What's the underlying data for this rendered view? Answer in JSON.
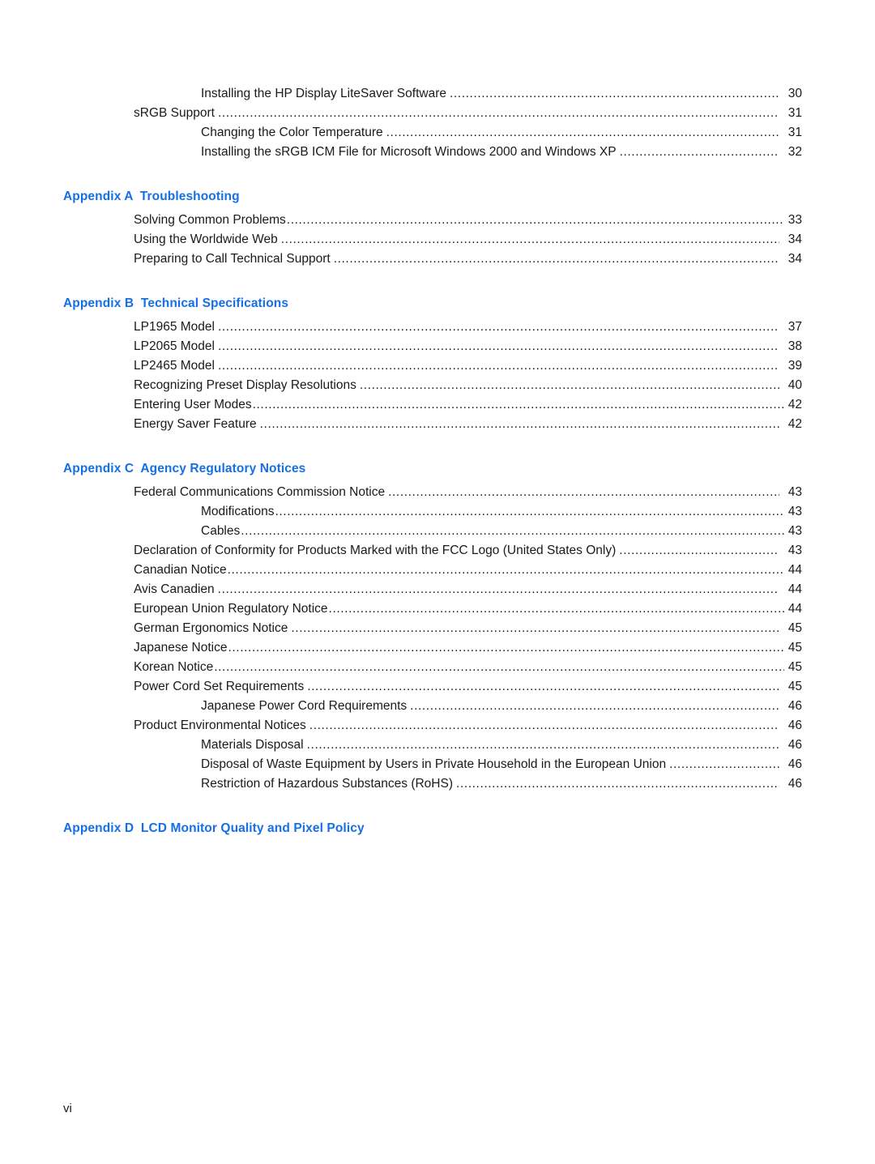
{
  "document": {
    "page_label": "vi",
    "heading_color": "#1570E8",
    "body_color": "#1a1a1a"
  },
  "toc": {
    "sections": [
      {
        "heading": "",
        "entries": [
          {
            "title": "Installing the HP Display LiteSaver Software",
            "page": "30",
            "level": 2,
            "tight": false
          },
          {
            "title": "sRGB Support",
            "page": "31",
            "level": 1,
            "tight": false
          },
          {
            "title": "Changing the Color Temperature",
            "page": "31",
            "level": 2,
            "tight": false
          },
          {
            "title": "Installing the sRGB ICM File for Microsoft Windows 2000 and Windows XP",
            "page": "32",
            "level": 2,
            "tight": false
          }
        ]
      },
      {
        "heading": "Appendix A  Troubleshooting",
        "entries": [
          {
            "title": "Solving Common Problems",
            "page": "33",
            "level": 1,
            "tight": true
          },
          {
            "title": "Using the Worldwide Web",
            "page": "34",
            "level": 1,
            "tight": false
          },
          {
            "title": "Preparing to Call Technical Support",
            "page": "34",
            "level": 1,
            "tight": false
          }
        ]
      },
      {
        "heading": "Appendix B  Technical Specifications",
        "entries": [
          {
            "title": "LP1965 Model",
            "page": "37",
            "level": 1,
            "tight": false
          },
          {
            "title": "LP2065 Model",
            "page": "38",
            "level": 1,
            "tight": false
          },
          {
            "title": "LP2465 Model",
            "page": "39",
            "level": 1,
            "tight": false
          },
          {
            "title": "Recognizing Preset Display Resolutions",
            "page": "40",
            "level": 1,
            "tight": false
          },
          {
            "title": "Entering User Modes",
            "page": "42",
            "level": 1,
            "tight": true
          },
          {
            "title": "Energy Saver Feature",
            "page": "42",
            "level": 1,
            "tight": false
          }
        ]
      },
      {
        "heading": "Appendix C  Agency Regulatory Notices",
        "entries": [
          {
            "title": "Federal Communications Commission Notice",
            "page": "43",
            "level": 1,
            "tight": false
          },
          {
            "title": "Modifications",
            "page": "43",
            "level": 2,
            "tight": true
          },
          {
            "title": "Cables",
            "page": "43",
            "level": 2,
            "tight": true
          },
          {
            "title": "Declaration of Conformity for Products Marked with the FCC Logo (United States Only)",
            "page": "43",
            "level": 1,
            "tight": false
          },
          {
            "title": "Canadian Notice",
            "page": "44",
            "level": 1,
            "tight": true
          },
          {
            "title": "Avis Canadien",
            "page": "44",
            "level": 1,
            "tight": false
          },
          {
            "title": "European Union Regulatory Notice",
            "page": "44",
            "level": 1,
            "tight": true
          },
          {
            "title": "German Ergonomics Notice",
            "page": "45",
            "level": 1,
            "tight": false
          },
          {
            "title": "Japanese Notice",
            "page": "45",
            "level": 1,
            "tight": true
          },
          {
            "title": "Korean Notice",
            "page": "45",
            "level": 1,
            "tight": true
          },
          {
            "title": "Power Cord Set Requirements",
            "page": "45",
            "level": 1,
            "tight": false
          },
          {
            "title": "Japanese Power Cord Requirements",
            "page": "46",
            "level": 2,
            "tight": false
          },
          {
            "title": "Product Environmental Notices",
            "page": "46",
            "level": 1,
            "tight": false
          },
          {
            "title": "Materials Disposal",
            "page": "46",
            "level": 2,
            "tight": false
          },
          {
            "title": "Disposal of Waste Equipment by Users in Private Household in the European Union",
            "page": "46",
            "level": 2,
            "tight": false
          },
          {
            "title": "Restriction of Hazardous Substances (RoHS)",
            "page": "46",
            "level": 2,
            "tight": false
          }
        ]
      },
      {
        "heading": "Appendix D  LCD Monitor Quality and Pixel Policy",
        "entries": []
      }
    ]
  }
}
